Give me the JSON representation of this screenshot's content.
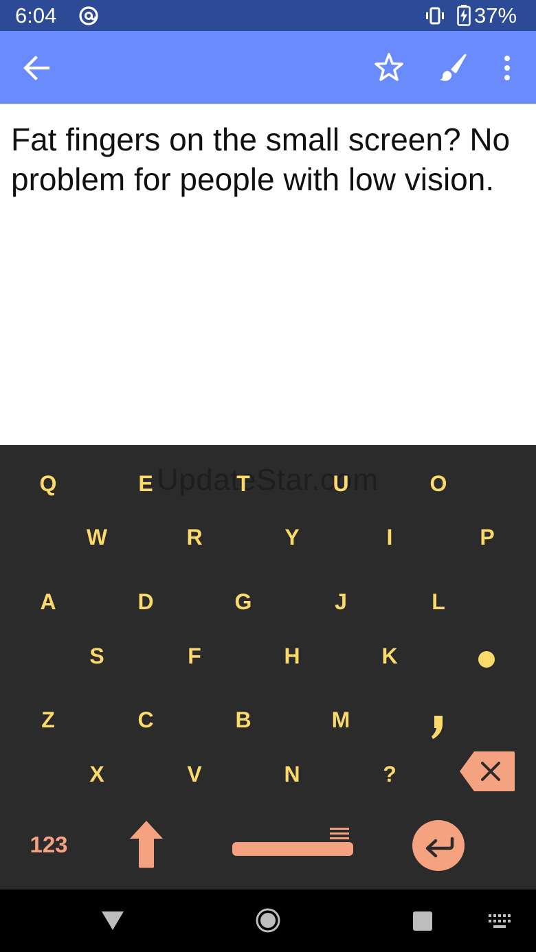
{
  "status_bar": {
    "time": "6:04",
    "battery_percent": "37%",
    "icons": [
      "alternate-email-icon",
      "vibrate-icon",
      "battery-charging-icon"
    ]
  },
  "app_bar": {
    "background_color": "#6a8bfd",
    "actions": [
      "back-arrow-icon",
      "star-outline-icon",
      "paint-brush-icon",
      "more-vert-icon"
    ]
  },
  "note": {
    "text": "Fat fingers on the small screen? No problem for people with low vision."
  },
  "keyboard": {
    "watermark": "UpdateStar.com",
    "key_color": "#fbd96a",
    "accent_color": "#f4a280",
    "background_color": "#2b2b2b",
    "rows": [
      [
        "Q",
        "E",
        "T",
        "U",
        "O"
      ],
      [
        "W",
        "R",
        "Y",
        "I",
        "P"
      ],
      [
        "A",
        "D",
        "G",
        "J",
        "L"
      ],
      [
        "S",
        "F",
        "H",
        "K"
      ],
      [
        "Z",
        "C",
        "B",
        "M"
      ],
      [
        "X",
        "V",
        "N",
        "?"
      ]
    ],
    "special_keys": {
      "numbers_label": "123",
      "shift": "shift-arrow-icon",
      "space": "space-bar",
      "enter": "enter-arrow-icon",
      "backspace": "backspace-icon",
      "period": "period-dot",
      "comma": "comma-glyph"
    }
  },
  "nav_bar": {
    "buttons": [
      "back-triangle-icon",
      "home-circle-icon",
      "recents-square-icon",
      "keyboard-switch-icon"
    ]
  }
}
